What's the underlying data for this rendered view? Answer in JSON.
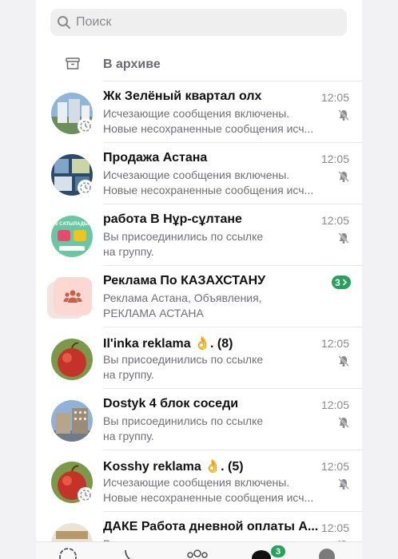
{
  "search": {
    "placeholder": "Поиск",
    "icon": "search-icon"
  },
  "archive": {
    "label": "В архиве",
    "icon": "archive-icon"
  },
  "chats": [
    {
      "name": "Жк Зелёный квартал олх",
      "time": "12:05",
      "line1": "Исчезающие сообщения включены.",
      "line2": "Новые несохраненные сообщения исч...",
      "muted": true,
      "disappearing": true
    },
    {
      "name": "Продажа Астана",
      "time": "12:05",
      "line1": "Исчезающие сообщения включены.",
      "line2": "Новые несохраненные сообщения исч...",
      "muted": true,
      "disappearing": true
    },
    {
      "name": "работа В Нұр-сұлтане",
      "time": "12:05",
      "line1": "Вы присоединились по ссылке",
      "line2": "на группу.",
      "muted": true,
      "avatar_text": "6 САТЫЛАДЫ"
    },
    {
      "name": "Реклама По КАЗАХСТАНУ",
      "line1": "Реклама Астана, Объявления,",
      "line2": "РЕКЛАМА АСТАНА",
      "badge": "3",
      "community": true
    },
    {
      "name": "Il'inka reklama 👌. (8)",
      "time": "12:05",
      "line1": "Вы присоединились по ссылке",
      "line2": "на группу.",
      "muted": true
    },
    {
      "name": "Dostyk 4 блок соседи",
      "time": "12:05",
      "line1": "Вы присоединились по ссылке",
      "line2": "на группу.",
      "muted": true
    },
    {
      "name": "Kosshy  reklama 👌.  (5)",
      "time": "12:05",
      "line1": "Исчезающие сообщения включены.",
      "line2": "Новые несохраненные сообщения исч...",
      "muted": true,
      "disappearing": true
    },
    {
      "name": "ДАКЕ Работа дневной оплаты А...",
      "time": "12:05",
      "line1": "Вы присоединились по ссылке",
      "line2": "",
      "muted": true
    }
  ],
  "tabbar": {
    "chats_badge": "3"
  },
  "colors": {
    "accent_green": "#25a35a",
    "secondary_text": "#707075",
    "search_bg": "#efeff0"
  }
}
